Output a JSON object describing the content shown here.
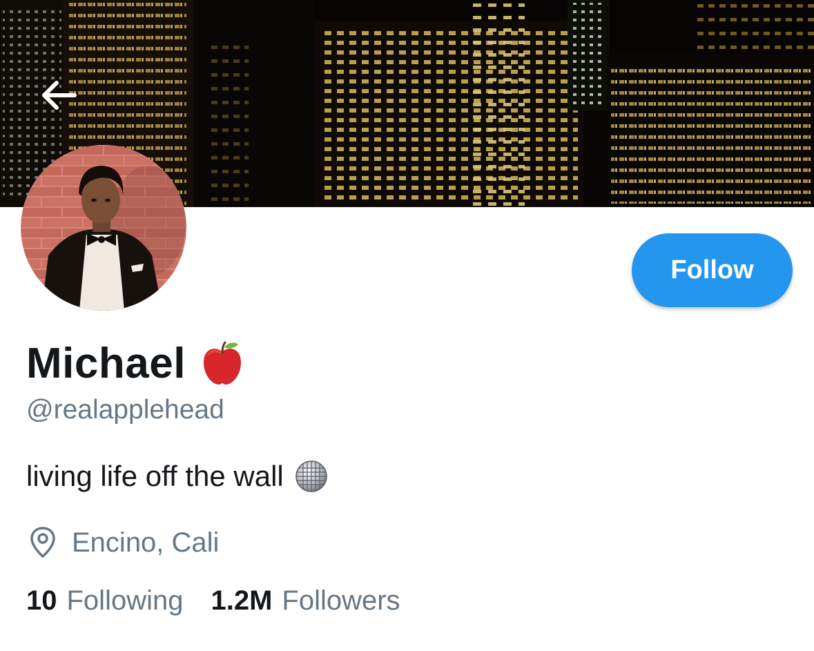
{
  "header": {
    "back_icon": "arrow-left-icon"
  },
  "profile": {
    "display_name": "Michael",
    "name_emoji": "red-apple-icon",
    "handle": "@realapplehead",
    "bio": "living life off the wall",
    "bio_emoji": "disco-ball-icon",
    "location_icon": "location-pin-icon",
    "location": "Encino, Cali"
  },
  "actions": {
    "follow_label": "Follow"
  },
  "stats": {
    "following_count": "10",
    "following_label": "Following",
    "followers_count": "1.2M",
    "followers_label": "Followers"
  },
  "colors": {
    "accent": "#2596ee",
    "secondary_text": "#657786",
    "primary_text": "#14171a"
  }
}
